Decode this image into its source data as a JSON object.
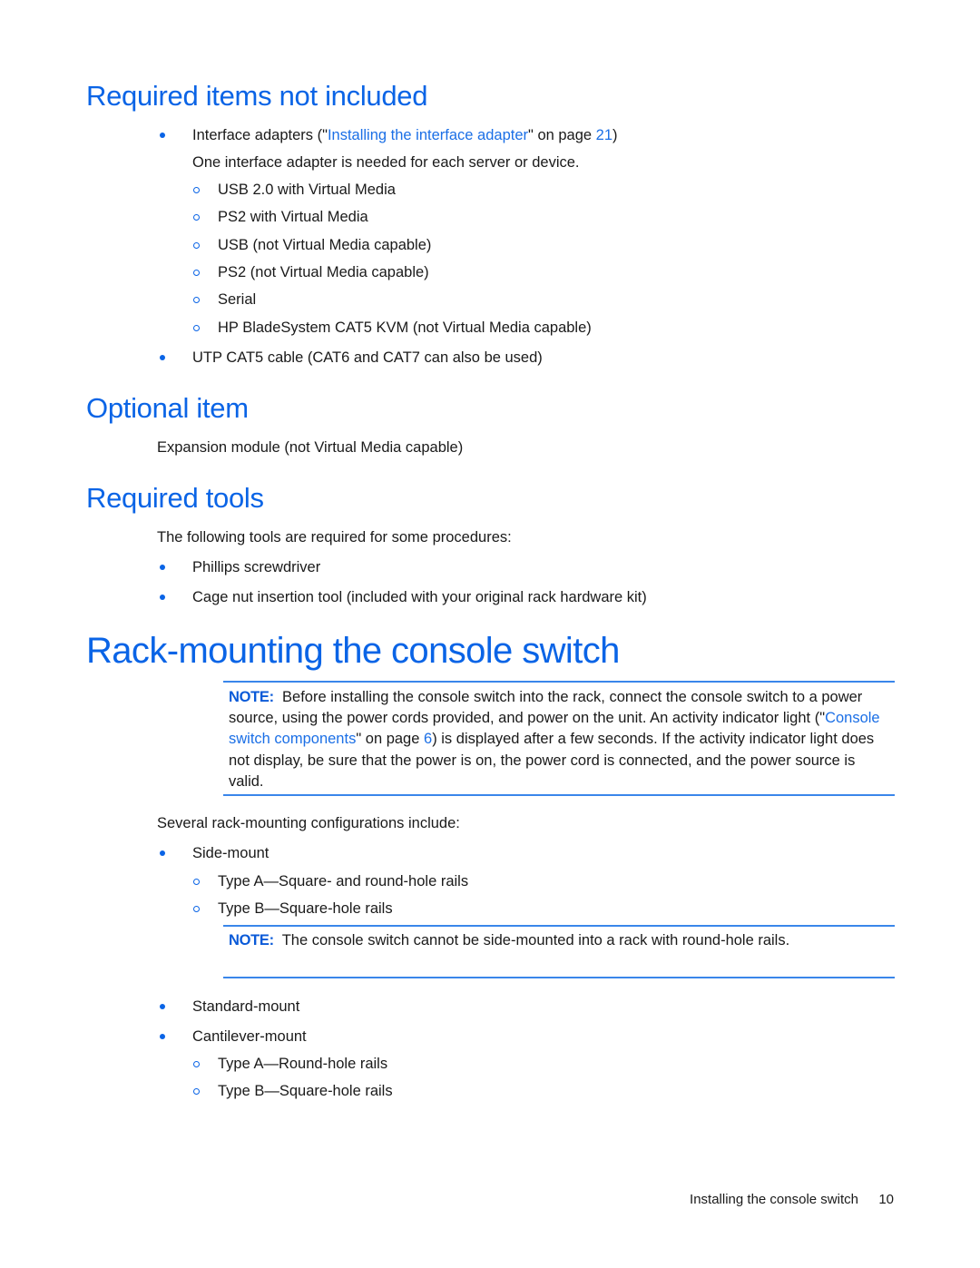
{
  "sections": {
    "required_items": {
      "heading": "Required items not included",
      "bullet1": {
        "prefix": "Interface adapters (\"",
        "link": "Installing the interface adapter",
        "mid": "\" on page ",
        "page_link": "21",
        "suffix": ")",
        "continuation": "One interface adapter is needed for each server or device.",
        "subitems": [
          "USB 2.0 with Virtual Media",
          "PS2 with Virtual Media",
          "USB (not Virtual Media capable)",
          "PS2 (not Virtual Media capable)",
          "Serial",
          "HP BladeSystem CAT5 KVM (not Virtual Media capable)"
        ]
      },
      "bullet2": "UTP CAT5 cable (CAT6 and CAT7 can also be used)"
    },
    "optional_item": {
      "heading": "Optional item",
      "text": "Expansion module (not Virtual Media capable)"
    },
    "required_tools": {
      "heading": "Required tools",
      "intro": "The following tools are required for some procedures:",
      "items": [
        "Phillips screwdriver",
        "Cage nut insertion tool (included with your original rack hardware kit)"
      ]
    },
    "rack_mounting": {
      "heading": "Rack-mounting the console switch",
      "note1": {
        "label": "NOTE:",
        "text_before": "Before installing the console switch into the rack, connect the console switch to a power source, using the power cords provided, and power on the unit. An activity indicator light (\"",
        "link": "Console switch components",
        "text_mid": "\" on page ",
        "page_link": "6",
        "text_after": ") is displayed after a few seconds. If the activity indicator light does not display, be sure that the power is on, the power cord is connected, and the power source is valid."
      },
      "intro": "Several rack-mounting configurations include:",
      "side_mount": {
        "label": "Side-mount",
        "subitems": [
          "Type A—Square- and round-hole rails",
          "Type B—Square-hole rails"
        ]
      },
      "note2": {
        "label": "NOTE:",
        "text": "The console switch cannot be side-mounted into a rack with round-hole rails."
      },
      "standard_mount": "Standard-mount",
      "cantilever_mount": {
        "label": "Cantilever-mount",
        "subitems": [
          "Type A—Round-hole rails",
          "Type B—Square-hole rails"
        ]
      }
    }
  },
  "footer": {
    "chapter": "Installing the console switch",
    "page_number": "10"
  },
  "colors": {
    "heading": "#0a64e6",
    "link": "#1b6fe6",
    "rule": "#3a86ea"
  }
}
